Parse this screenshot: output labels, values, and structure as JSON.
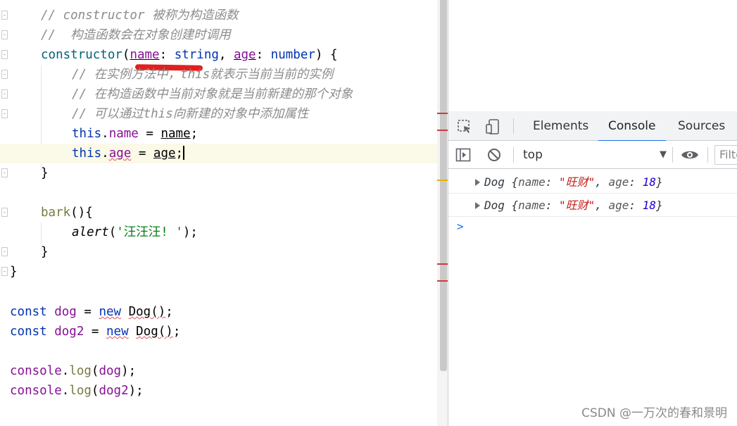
{
  "editor": {
    "lines": {
      "l1": "// constructor 被称为构造函数",
      "l2": "//  构造函数会在对象创建时调用",
      "l3_kw": "constructor",
      "l3_name": "name",
      "l3_string": "string",
      "l3_age": "age",
      "l3_number": "number",
      "l4": "// 在实例方法中，this就表示当前当前的实例",
      "l5": "// 在构造函数中当前对象就是当前新建的那个对象",
      "l6": "// 可以通过this向新建的对象中添加属性",
      "this": "this",
      "name": "name",
      "age": "age",
      "bark": "bark",
      "alert": "alert",
      "alert_str": "'汪汪汪! '",
      "const": "const",
      "dog": "dog",
      "dog2": "dog2",
      "new": "new",
      "Dog": "Dog",
      "console": "console",
      "log": "log"
    }
  },
  "devtools": {
    "tabs": [
      "Elements",
      "Console",
      "Sources"
    ],
    "active_tab": "Console",
    "context": "top",
    "filter_placeholder": "Filter",
    "logs": [
      {
        "class": "Dog",
        "name_key": "name",
        "name_val": "\"旺财\"",
        "age_key": "age",
        "age_val": "18"
      },
      {
        "class": "Dog",
        "name_key": "name",
        "name_val": "\"旺财\"",
        "age_key": "age",
        "age_val": "18"
      }
    ],
    "prompt": ">"
  },
  "watermark": "CSDN @一万次的春和景明",
  "colors": {
    "keyword": "#0033b3",
    "comment": "#8c8c8c",
    "string": "#067d17",
    "accent": "#1a73e8"
  }
}
